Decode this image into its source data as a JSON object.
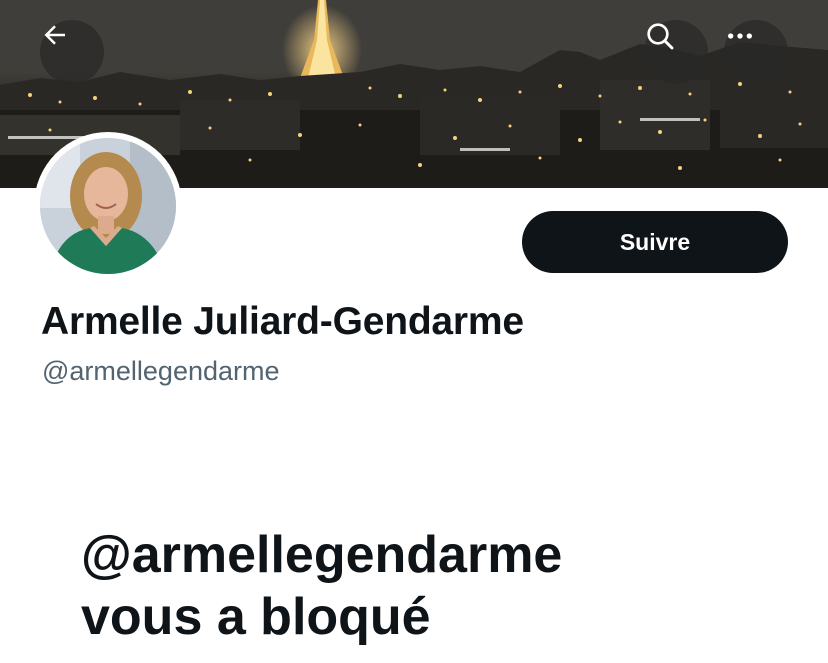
{
  "header": {
    "back_icon": "arrow-left-icon",
    "search_icon": "search-icon",
    "more_icon": "more-horizontal-icon",
    "banner_image": "paris-night-skyline-with-eiffel-tower"
  },
  "profile": {
    "display_name": "Armelle Juliard-Gendarme",
    "handle": "@armellegendarme",
    "follow_label": "Suivre",
    "avatar_image": "profile-photo-woman-green-top"
  },
  "blocked_notice": {
    "line1": "@armellegendarme",
    "line2": "vous a bloqué"
  },
  "colors": {
    "primary_text": "#0f1419",
    "secondary_text": "#536471",
    "follow_button_bg": "#0f1419",
    "follow_button_text": "#ffffff"
  }
}
